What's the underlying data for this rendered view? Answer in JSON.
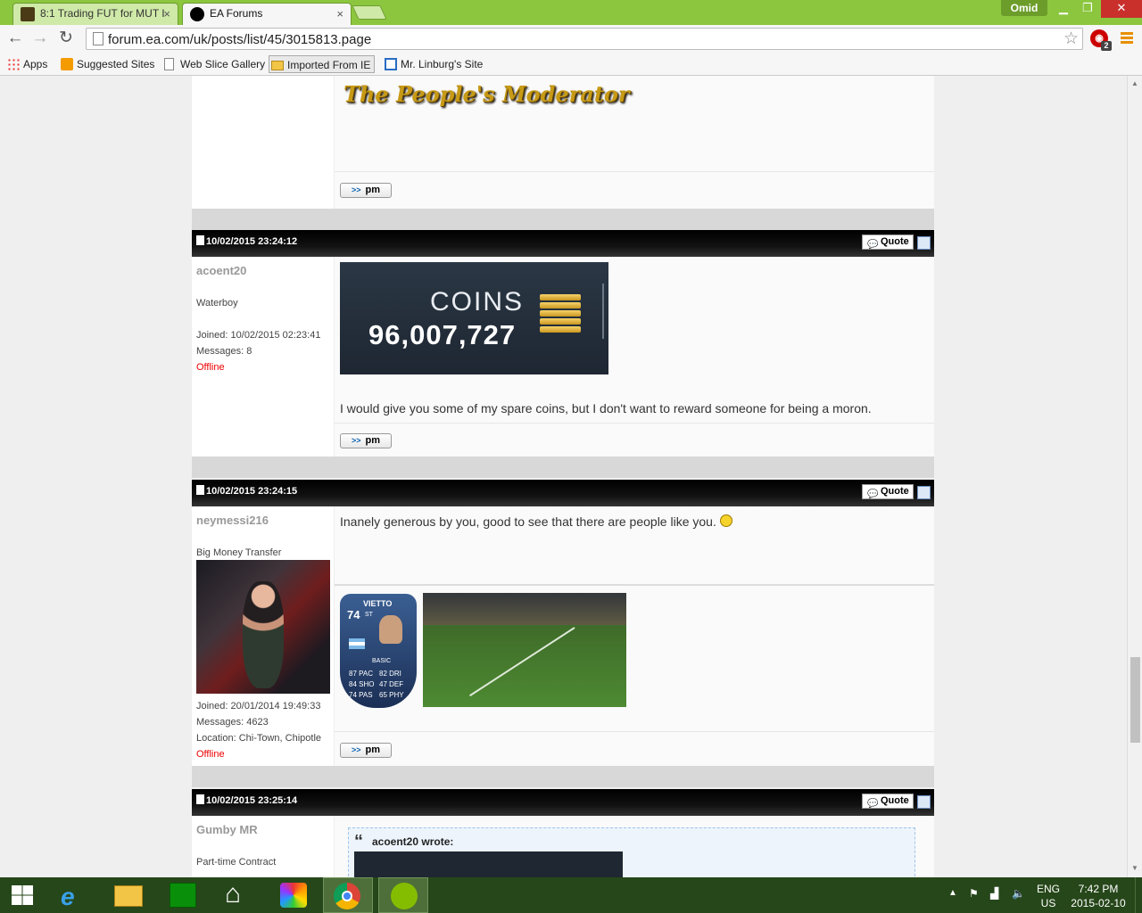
{
  "browser": {
    "tabs": [
      {
        "label": "8:1 Trading FUT for MUT I",
        "close": "×"
      },
      {
        "label": "EA Forums",
        "close": "×"
      }
    ],
    "user": "Omid",
    "url": "forum.ea.com/uk/posts/list/45/3015813.page",
    "extension_badge": "2",
    "bookmarks": [
      "Apps",
      "Suggested Sites",
      "Web Slice Gallery",
      "Imported From IE",
      "Mr. Linburg's Site"
    ]
  },
  "signature_top": {
    "text": "The People's Moderator",
    "pm_label": "pm"
  },
  "posts": [
    {
      "date": "10/02/2015 23:24:12",
      "quote_label": "Quote",
      "username": "acoent20",
      "rank": "Waterboy",
      "joined": "Joined: 10/02/2015 02:23:41",
      "messages": "Messages: 8",
      "status": "Offline",
      "image": {
        "title": "COINS",
        "value": "96,007,727"
      },
      "message": "I would give you some of my spare coins, but I don't want to reward someone for being a moron.",
      "pm_label": "pm"
    },
    {
      "date": "10/02/2015 23:24:15",
      "quote_label": "Quote",
      "username": "neymessi216",
      "rank": "Big Money Transfer",
      "joined": "Joined: 20/01/2014 19:49:33",
      "messages": "Messages: 4623",
      "location": "Location: Chi-Town, Chipotle",
      "status": "Offline",
      "message": "Inanely generous by you, good to see that there are people like you.",
      "card": {
        "name": "VIETTO",
        "rating": "74",
        "position": "ST",
        "chem": "BASIC",
        "stats": [
          "87 PAC",
          "82 DRI",
          "84 SHO",
          "47 DEF",
          "74 PAS",
          "65 PHY"
        ]
      },
      "pm_label": "pm"
    },
    {
      "date": "10/02/2015 23:25:14",
      "quote_label": "Quote",
      "username": "Gumby MR",
      "rank": "Part-time Contract",
      "quote_author": "acoent20 wrote:"
    }
  ],
  "taskbar": {
    "lang": "ENG",
    "region": "US",
    "time": "7:42 PM",
    "date": "2015-02-10"
  },
  "colors": {
    "chrome_green": "#8cc63f",
    "taskbar": "#26471a",
    "offline": "#e00000"
  }
}
